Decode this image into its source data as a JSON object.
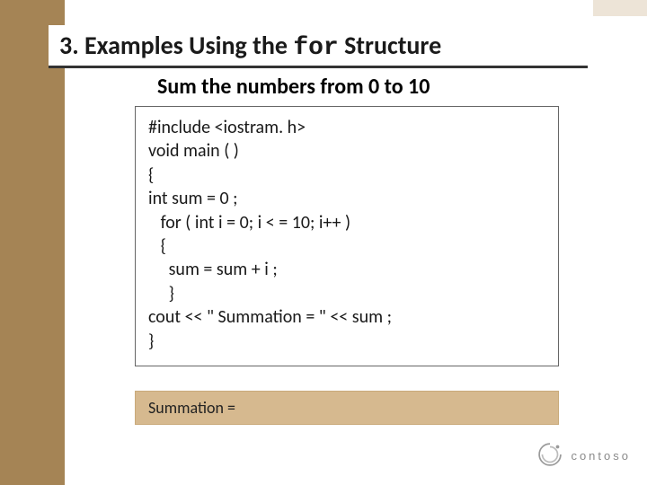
{
  "title": {
    "prefix": "3. Examples Using the ",
    "mono": "for",
    "suffix": " Structure"
  },
  "subtitle": "Sum the numbers from 0 to 10",
  "code_lines": [
    "#include <iostram. h>",
    "void main ( )",
    "{",
    "int sum = 0 ;",
    "   for ( int i = 0; i < = 10; i++ )",
    "   {",
    "     sum = sum + i ;",
    "     }",
    "cout << \" Summation = \" << sum ;",
    "}"
  ],
  "output": "Summation =",
  "logo_text": "contoso",
  "colors": {
    "sidebar": "#a58455",
    "output_bg": "#d6b98f"
  }
}
